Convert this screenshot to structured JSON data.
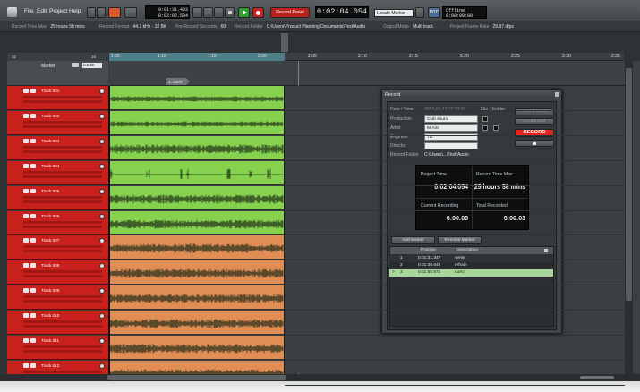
{
  "menu": [
    "File",
    "Edit",
    "Project",
    "Help"
  ],
  "toolbar": {
    "time_top": "0:01:31.403",
    "time_bottom": "0:02:02.504",
    "record_panel_label": "Record Panel",
    "main_time": "0:02:04.054",
    "locate_marker": "Locate Marker",
    "mtc": "MTC",
    "offline": "Offline",
    "offline_time": "0:00:00:00"
  },
  "infobar": [
    {
      "label": "Record Time Max",
      "value": "25 hours 58 mins"
    },
    {
      "label": "Record Format",
      "value": "44.1 kHz - 32 Bit"
    },
    {
      "label": "Pre-Record Seconds",
      "value": "60"
    },
    {
      "label": "Record Folder",
      "value": "C:\\Users\\Product Planning\\Documents\\Test\\Audio"
    },
    {
      "label": "Output Mode",
      "value": "Multi track"
    },
    {
      "label": "Project Frame Rate",
      "value": "29.97 dfps"
    }
  ],
  "marker_header": {
    "label": "Marker",
    "locate": "Locate",
    "num_a": "32",
    "num_b": "16"
  },
  "ruler_ticks": [
    "1:05",
    "1:10",
    "1:15",
    "2:00",
    "2:05",
    "2:10",
    "2:15",
    "2:20",
    "2:25",
    "2:30",
    "2:35"
  ],
  "marker_tag": "3: outro",
  "tracks": [
    {
      "name": "Track 001",
      "color": "green"
    },
    {
      "name": "Track 002",
      "color": "green"
    },
    {
      "name": "Track 003",
      "color": "green"
    },
    {
      "name": "Track 004",
      "color": "green"
    },
    {
      "name": "Track 005",
      "color": "green"
    },
    {
      "name": "Track 006",
      "color": "green"
    },
    {
      "name": "Track 007",
      "color": "orange"
    },
    {
      "name": "Track 008",
      "color": "orange"
    },
    {
      "name": "Track 009",
      "color": "orange"
    },
    {
      "name": "Track 010",
      "color": "orange"
    },
    {
      "name": "Track 011",
      "color": "orange"
    },
    {
      "name": "Track 012",
      "color": "orange"
    }
  ],
  "colors": {
    "green": "#86d24f",
    "orange": "#e08d56",
    "track_header": "#c8201d",
    "record_button": "#e0241f"
  },
  "dialog": {
    "title": "Record",
    "date_label": "Date / Time",
    "date_value": "2012-01-13 12:32:29",
    "file_label": "File",
    "folder_label": "Folder",
    "production_label": "Production",
    "production_value": "Club sound",
    "artist_label": "Artist",
    "artist_value": "M.Aris",
    "engineer_label": "Engineer",
    "engineer_value": "TD",
    "director_label": "Director",
    "director_value": "",
    "record_folder_label": "Record Folder",
    "record_folder_value": "C:\\Users\\...\\Test\\Audio",
    "arm_all": "Arm All Tracks",
    "locate_end": "Locate End",
    "record": "RECORD",
    "project_time_label": "Project Time",
    "project_time_value": "0:02:04.054",
    "record_time_max_label": "Record Time Max",
    "record_time_max_value": "25 hours 58 mins",
    "current_recording_label": "Current Recording",
    "current_recording_value": "0:00:00",
    "total_recorded_label": "Total Recorded",
    "total_recorded_value": "0:00:03",
    "add_marker": "Add Marker",
    "remove_marker": "Remove Marker",
    "marker_columns": [
      "Position",
      "Description"
    ],
    "markers": [
      {
        "id": "1",
        "position": "0:01:31.347",
        "description": "verse",
        "current": ""
      },
      {
        "id": "2",
        "position": "0:01:38.644",
        "description": "refrain",
        "current": ""
      },
      {
        "id": "3",
        "position": "0:01:50.871",
        "description": "outro",
        "current": ">"
      }
    ]
  }
}
